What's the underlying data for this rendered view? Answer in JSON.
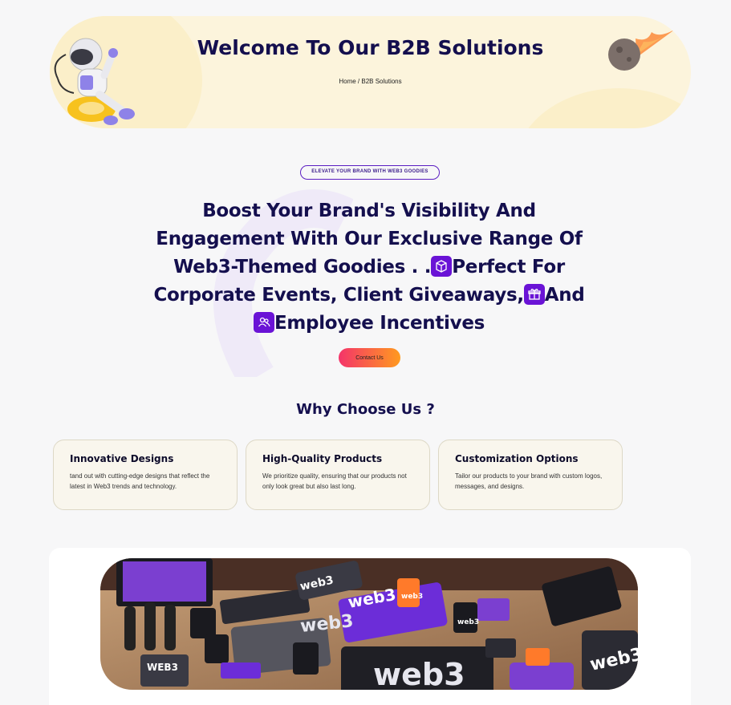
{
  "hero": {
    "title": "Welcome To Our B2B Solutions",
    "breadcrumb": "Home / B2B Solutions"
  },
  "badge": "ELEVATE YOUR BRAND WITH WEB3 GOODIES",
  "headline": {
    "part1": "Boost Your Brand's Visibility And Engagement With Our Exclusive Range Of Web3-Themed Goodies . .",
    "part2": "Perfect For Corporate Events, Client Giveaways,",
    "part3": "And",
    "part4": "Employee Incentives",
    "icons": [
      "cube-icon",
      "gift-icon",
      "users-icon"
    ]
  },
  "contact_button": "Contact Us",
  "why": {
    "title": "Why Choose Us ?",
    "cards": [
      {
        "title": "Innovative Designs",
        "text": "tand out with cutting-edge designs that reflect the latest in Web3 trends and technology."
      },
      {
        "title": "High-Quality Products",
        "text": "We prioritize quality, ensuring that our products not only look great but also last long."
      },
      {
        "title": "Customization Options",
        "text": "Tailor our products to your brand with custom logos, messages, and designs."
      }
    ]
  },
  "photo": {
    "labels": [
      "web3",
      "web3",
      "web3",
      "web3",
      "web3",
      "web3",
      "web3",
      "WEB3"
    ]
  },
  "colors": {
    "navy": "#140f4e",
    "accent": "#6a13d6",
    "hero_bg": "#fcf4dc",
    "button_from": "#f4346a",
    "button_to": "#ff9a1f"
  }
}
